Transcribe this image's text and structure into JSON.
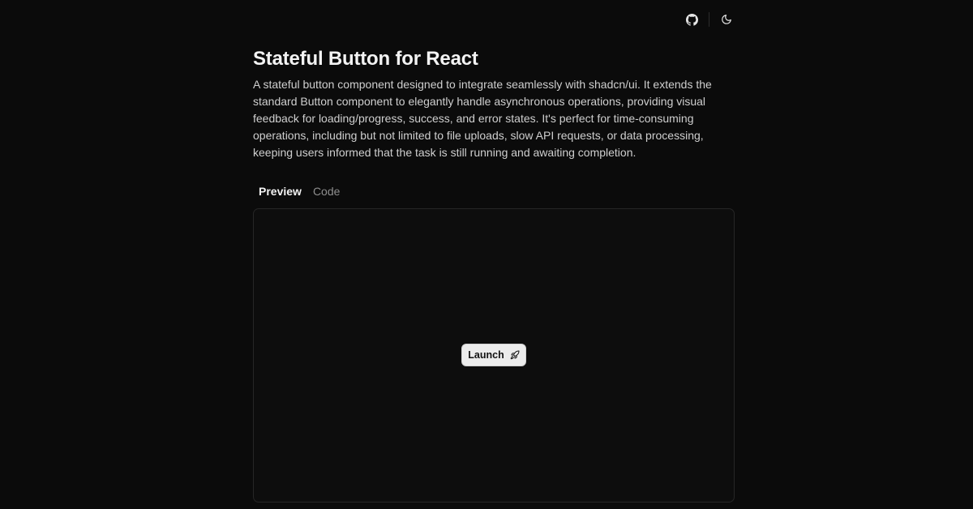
{
  "header": {
    "icons": {
      "github": "github-icon",
      "theme": "moon-icon"
    }
  },
  "main": {
    "title": "Stateful Button for React",
    "description": "A stateful button component designed to integrate seamlessly with shadcn/ui. It extends the standard Button component to elegantly handle asynchronous operations, providing visual feedback for loading/progress, success, and error states. It's perfect for time-consuming operations, including but not limited to file uploads, slow API requests, or data processing, keeping users informed that the task is still running and awaiting completion.",
    "tabs": [
      {
        "label": "Preview",
        "active": true
      },
      {
        "label": "Code",
        "active": false
      }
    ],
    "preview": {
      "button_label": "Launch",
      "button_icon": "rocket-icon"
    }
  },
  "colors": {
    "background": "#0b0b0b",
    "text": "#e8e8e8",
    "muted": "#8f8f8f",
    "button_bg": "#ececec",
    "border": "#262626"
  }
}
